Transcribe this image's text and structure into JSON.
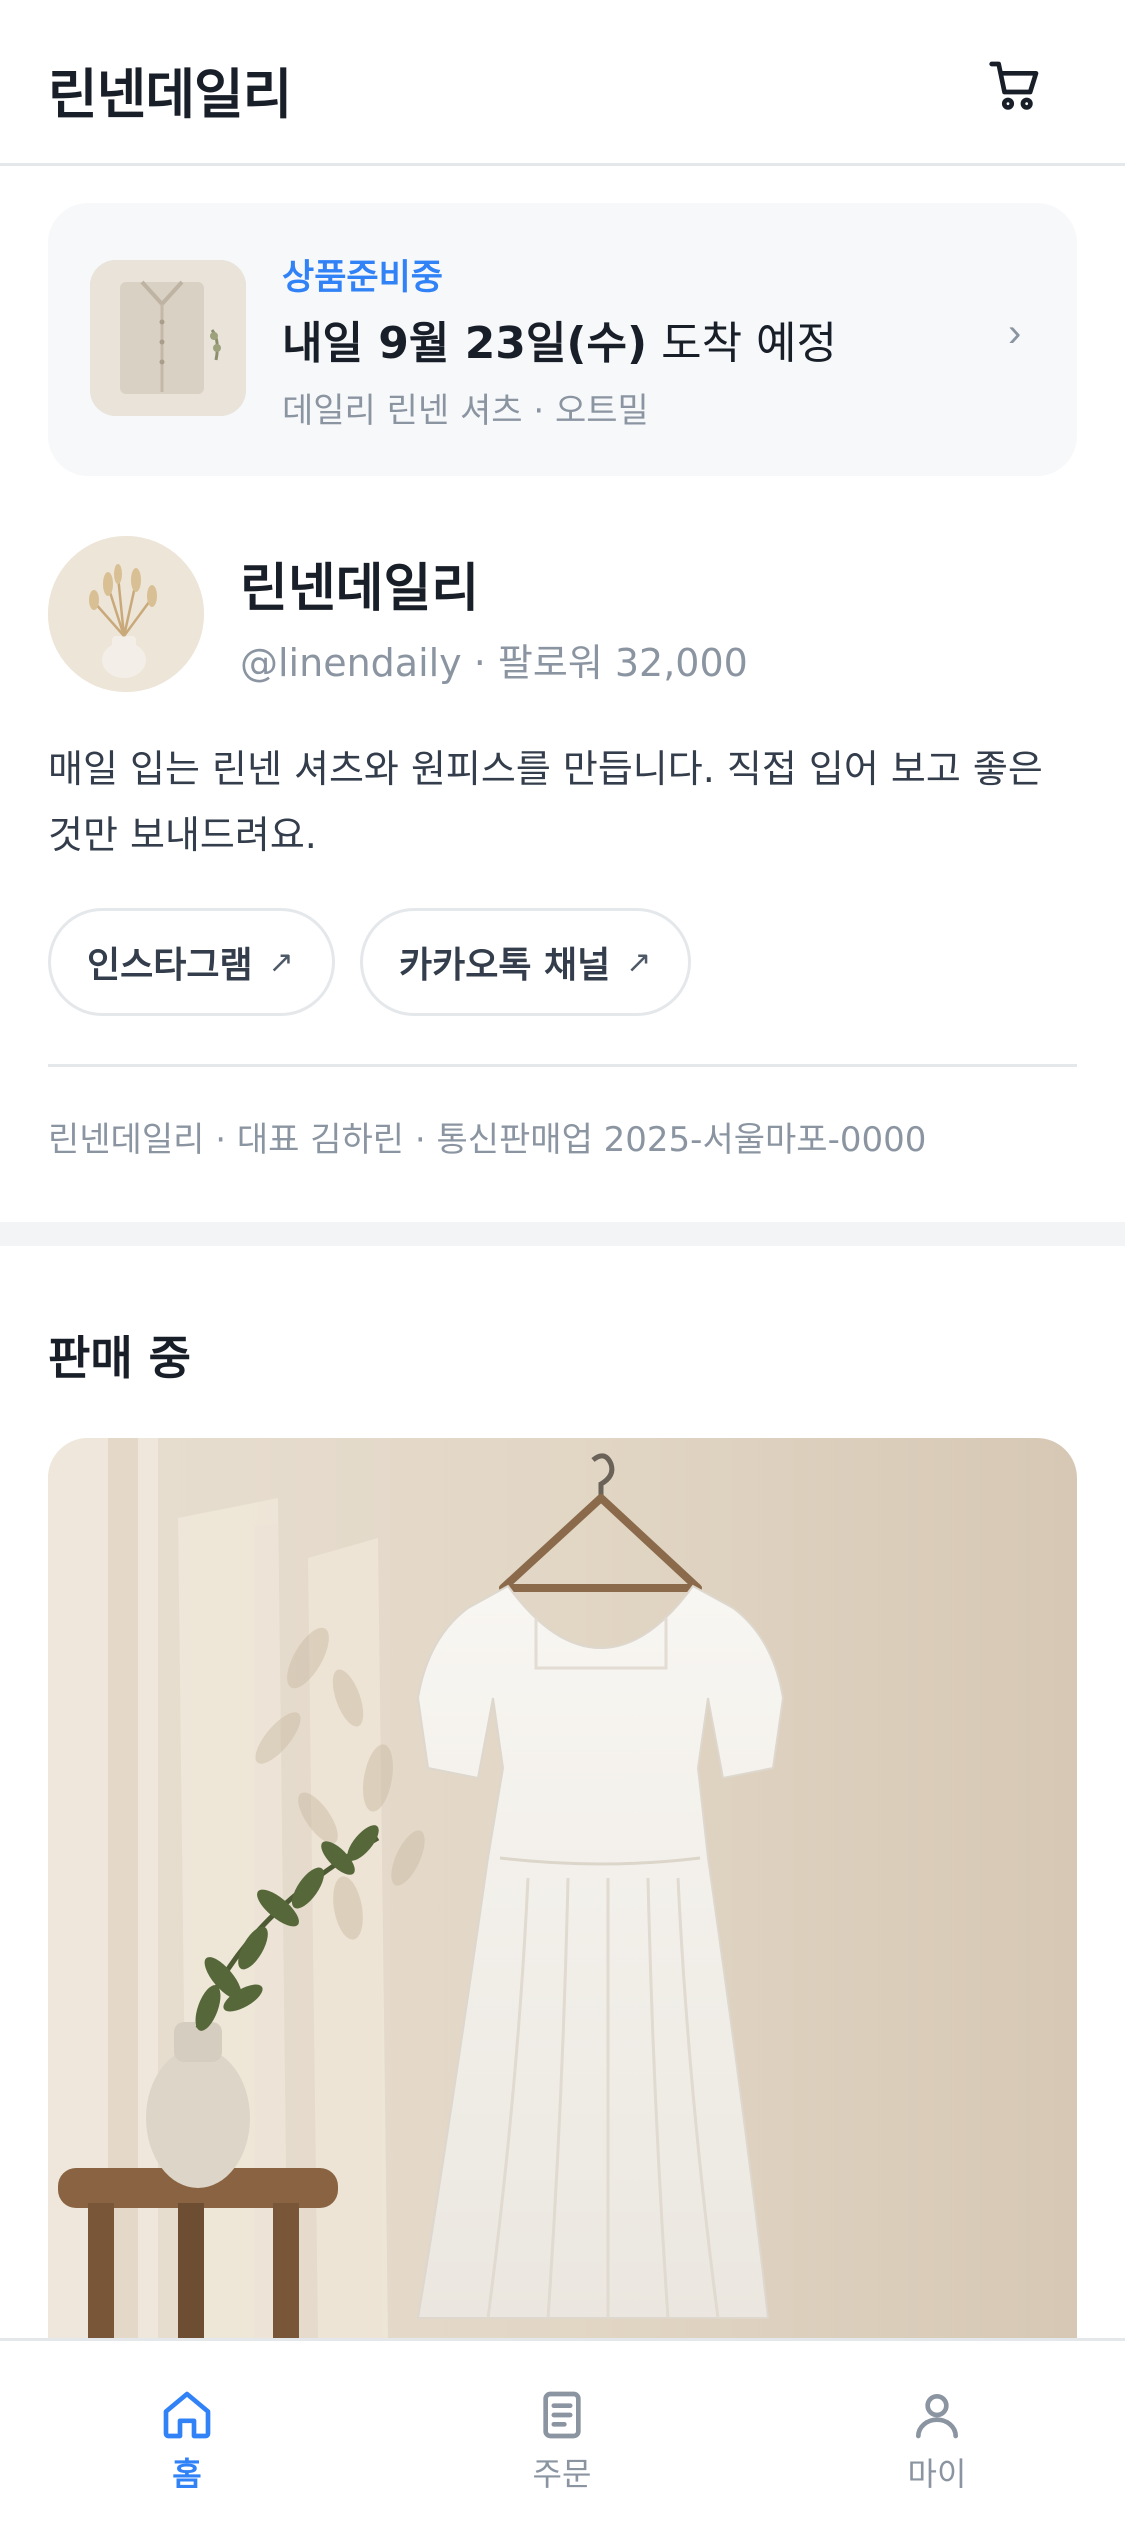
{
  "header": {
    "title": "린넨데일리",
    "cart_icon": "cart-icon"
  },
  "delivery": {
    "status": "상품준비중",
    "headline_bold": "내일 9월 23일(수)",
    "headline_rest": " 도착 예정",
    "item": "데일리 린넨 셔츠 · 오트밀",
    "chevron": "›"
  },
  "profile": {
    "name": "린넨데일리",
    "meta": "@linendaily · 팔로워 32,000",
    "description": "매일 입는 린넨 셔츠와 원피스를 만듭니다. 직접 입어 보고 좋은 것만 보내드려요.",
    "links": [
      {
        "label": "인스타그램",
        "arrow": "↗"
      },
      {
        "label": "카카오톡 채널",
        "arrow": "↗"
      }
    ],
    "business_info": "린넨데일리 · 대표 김하린 · 통신판매업 2025-서울마포-0000"
  },
  "selling": {
    "section_title": "판매 중"
  },
  "tabbar": {
    "items": [
      {
        "label": "홈",
        "icon": "home-icon",
        "active": true
      },
      {
        "label": "주문",
        "icon": "document-icon",
        "active": false
      },
      {
        "label": "마이",
        "icon": "person-icon",
        "active": false
      }
    ]
  },
  "colors": {
    "accent": "#3182f6",
    "text_primary": "#191f28",
    "text_secondary": "#8b95a1",
    "card_bg": "#f7f8fa",
    "divider": "#e5e8eb"
  }
}
